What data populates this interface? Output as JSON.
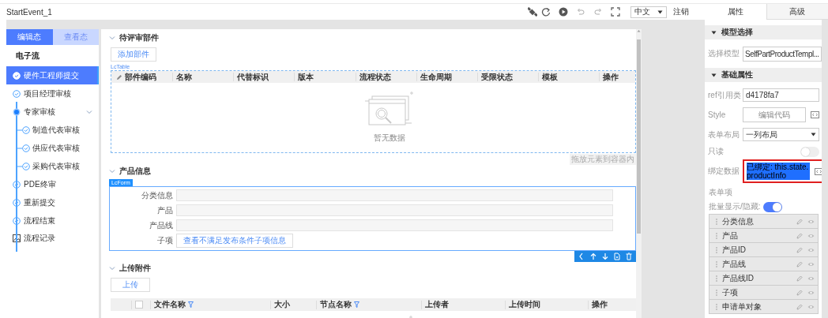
{
  "header": {
    "title": "StartEvent_1",
    "language": "中文",
    "logout": "注销"
  },
  "sidebar": {
    "tabs": [
      {
        "label": "编辑态",
        "selected": true
      },
      {
        "label": "查看态",
        "selected": false
      }
    ],
    "heading": "电子流",
    "steps": [
      {
        "label": "硬件工程师提交",
        "selected": true,
        "current": false
      },
      {
        "label": "项目经理审核",
        "selected": false,
        "current": false
      },
      {
        "label": "专家审核",
        "selected": false,
        "current": true,
        "expanded": true,
        "children": [
          {
            "label": "制造代表审核",
            "selected": false,
            "current": false
          },
          {
            "label": "供应代表审核",
            "selected": false,
            "current": false
          },
          {
            "label": "采购代表审核",
            "selected": false,
            "current": false
          }
        ]
      },
      {
        "label": "PDE终审",
        "selected": false,
        "current": false
      },
      {
        "label": "重新提交",
        "selected": false,
        "current": false
      },
      {
        "label": "流程结束",
        "selected": false,
        "current": false
      }
    ],
    "record": "流程记录"
  },
  "pending_parts": {
    "title": "待评审部件",
    "add_button": "添加部件",
    "table_tag": "LcTable",
    "columns": [
      "部件编码",
      "名称",
      "代替标识",
      "版本",
      "流程状态",
      "生命周期",
      "受限状态",
      "模板",
      "操作"
    ],
    "empty_text": "暂无数据",
    "drop_hint": "拖放元素到容器内"
  },
  "product_info": {
    "title": "产品信息",
    "form_tag": "LcForm",
    "fields": [
      {
        "label": "分类信息",
        "kind": "input"
      },
      {
        "label": "产品",
        "kind": "input"
      },
      {
        "label": "产品线",
        "kind": "input"
      },
      {
        "label": "子项",
        "kind": "button",
        "button": "查看不满足发布条件子项信息"
      }
    ]
  },
  "attachments": {
    "title": "上传附件",
    "upload_button": "上传",
    "select_all_checked": false,
    "columns": [
      {
        "label": "文件名称",
        "filter": true
      },
      {
        "label": "大小",
        "filter": false
      },
      {
        "label": "节点名称",
        "filter": true
      },
      {
        "label": "上传者",
        "filter": false
      },
      {
        "label": "上传时间",
        "filter": false
      },
      {
        "label": "操作",
        "filter": false
      }
    ]
  },
  "properties": {
    "tabs": [
      {
        "label": "属性",
        "selected": true
      },
      {
        "label": "高级",
        "selected": false
      }
    ],
    "model_section": "模型选择",
    "model_label": "选择模型",
    "model_value": "SelfPartProductTempl...",
    "basic_section": "基础属性",
    "rows": [
      {
        "kind": "text",
        "label": "ref引用类",
        "value": "d4178fa7"
      },
      {
        "kind": "code",
        "label": "Style",
        "button": "编辑代码"
      },
      {
        "kind": "select",
        "label": "表单布局",
        "value": "一列布局"
      },
      {
        "kind": "toggle",
        "label": "只读",
        "on": false
      },
      {
        "kind": "binding",
        "label": "绑定数据",
        "value": "已绑定: this.state.productInfo",
        "highlighted": true
      }
    ],
    "form_items_label": "表单项",
    "batch_label": "批量显示/隐藏:",
    "batch_on": true,
    "form_items": [
      "分类信息",
      "产品",
      "产品ID",
      "产品线",
      "产品线ID",
      "子项",
      "申请单对象"
    ]
  }
}
